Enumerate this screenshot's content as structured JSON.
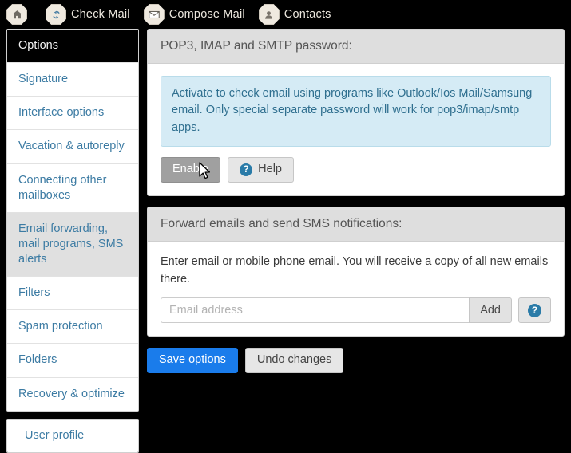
{
  "topnav": {
    "items": [
      {
        "icon": "home-icon",
        "label": ""
      },
      {
        "icon": "refresh-icon",
        "label": "Check Mail"
      },
      {
        "icon": "envelope-icon",
        "label": "Compose Mail"
      },
      {
        "icon": "user-icon",
        "label": "Contacts"
      }
    ]
  },
  "sidebar": {
    "items": [
      {
        "label": "Options",
        "state": "active"
      },
      {
        "label": "Signature",
        "state": "normal"
      },
      {
        "label": "Interface options",
        "state": "normal"
      },
      {
        "label": "Vacation & autoreply",
        "state": "normal"
      },
      {
        "label": "Connecting other mailboxes",
        "state": "normal"
      },
      {
        "label": "Email forwarding, mail programs, SMS alerts",
        "state": "selected"
      },
      {
        "label": "Filters",
        "state": "normal"
      },
      {
        "label": "Spam protection",
        "state": "normal"
      },
      {
        "label": "Folders",
        "state": "normal"
      },
      {
        "label": "Recovery & optimize",
        "state": "normal"
      }
    ],
    "profile_card": {
      "label": "User profile"
    }
  },
  "panels": {
    "pop3": {
      "title": "POP3, IMAP and SMTP password:",
      "alert": "Activate to check email using programs like Outlook/Ios Mail/Samsung email. Only special separate password will work for pop3/imap/smtp apps.",
      "enable_label": "Enable",
      "help_label": "Help",
      "help_icon": "question-circle-icon"
    },
    "forward": {
      "title": "Forward emails and send SMS notifications:",
      "description": "Enter email or mobile phone email. You will receive a copy of all new emails there.",
      "input_value": "",
      "input_placeholder": "Email address",
      "add_label": "Add",
      "help_icon": "question-circle-icon"
    }
  },
  "footer": {
    "save_label": "Save options",
    "undo_label": "Undo changes"
  },
  "colors": {
    "accent_blue": "#1a7ceb",
    "link_blue": "#3c7ba3",
    "info_bg": "#d5ebf5",
    "info_border": "#b9dcea",
    "info_text": "#2f6f8f",
    "panel_head_bg": "#dedede",
    "page_bg": "#000000",
    "selected_bg": "#e0e0e0",
    "hover_btn_bg": "#a0a0a0"
  }
}
